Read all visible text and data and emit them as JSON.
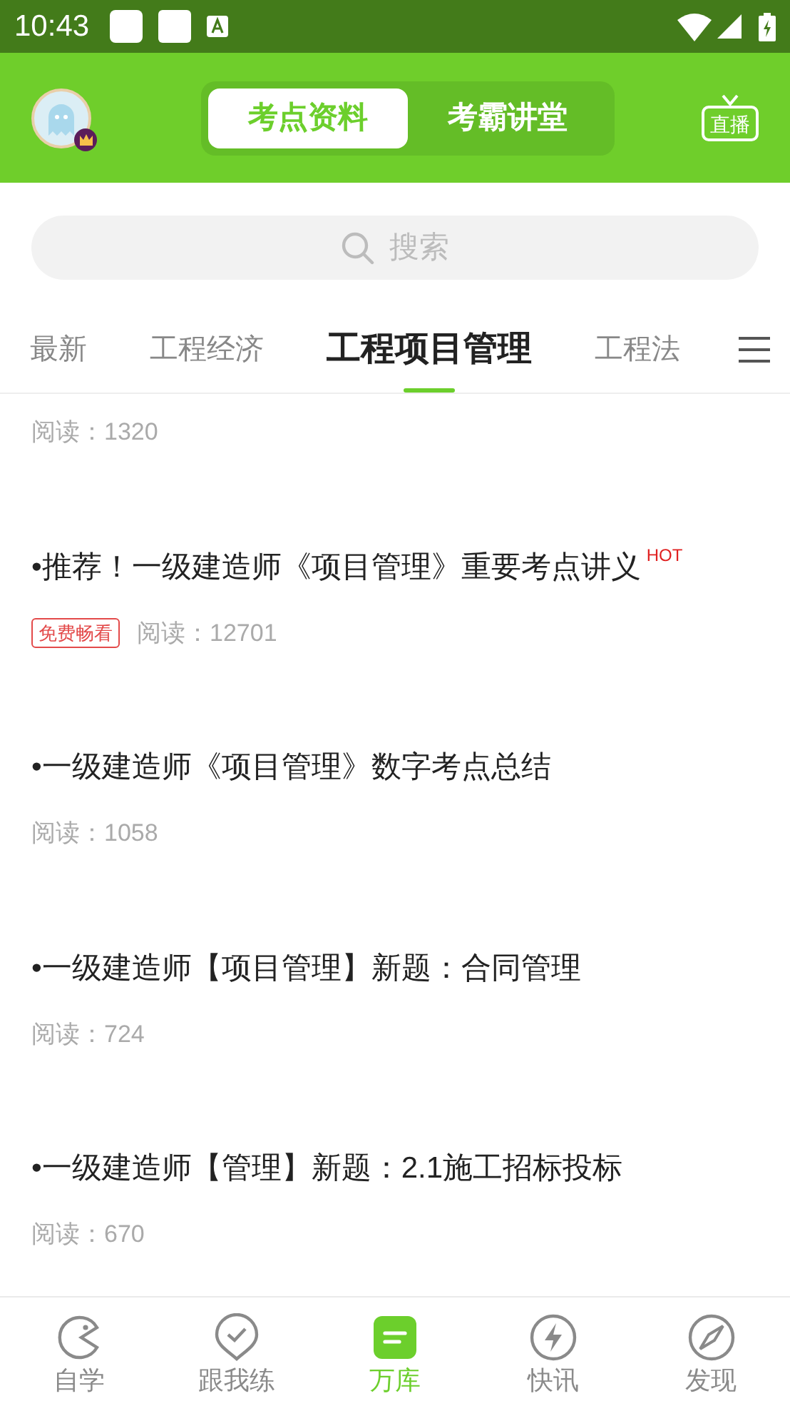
{
  "status_bar": {
    "time": "10:43"
  },
  "header": {
    "segments": [
      {
        "label": "考点资料",
        "selected": true
      },
      {
        "label": "考霸讲堂",
        "selected": false
      }
    ],
    "live_label": "直播"
  },
  "search": {
    "placeholder": "搜索"
  },
  "category_tabs": [
    {
      "label": "最新",
      "selected": false
    },
    {
      "label": "工程经济",
      "selected": false
    },
    {
      "label": "工程项目管理",
      "selected": true
    },
    {
      "label": "工程法",
      "selected": false
    }
  ],
  "articles": [
    {
      "reads": "阅读：1320"
    },
    {
      "title": "•推荐！一级建造师《项目管理》重要考点讲义",
      "hot": "HOT",
      "tag": "免费畅看",
      "reads": "阅读：12701"
    },
    {
      "title": "•一级建造师《项目管理》数字考点总结",
      "reads": "阅读：1058"
    },
    {
      "title": "•一级建造师【项目管理】新题：合同管理",
      "reads": "阅读：724"
    },
    {
      "title": "•一级建造师【管理】新题：2.1施工招标投标",
      "reads": "阅读：670"
    }
  ],
  "bottom_nav": [
    {
      "kind": "self",
      "label": "自学",
      "selected": false
    },
    {
      "kind": "practice",
      "label": "跟我练",
      "selected": false
    },
    {
      "kind": "library",
      "label": "万库",
      "selected": true
    },
    {
      "kind": "news",
      "label": "快讯",
      "selected": false
    },
    {
      "kind": "discover",
      "label": "发现",
      "selected": false
    }
  ]
}
